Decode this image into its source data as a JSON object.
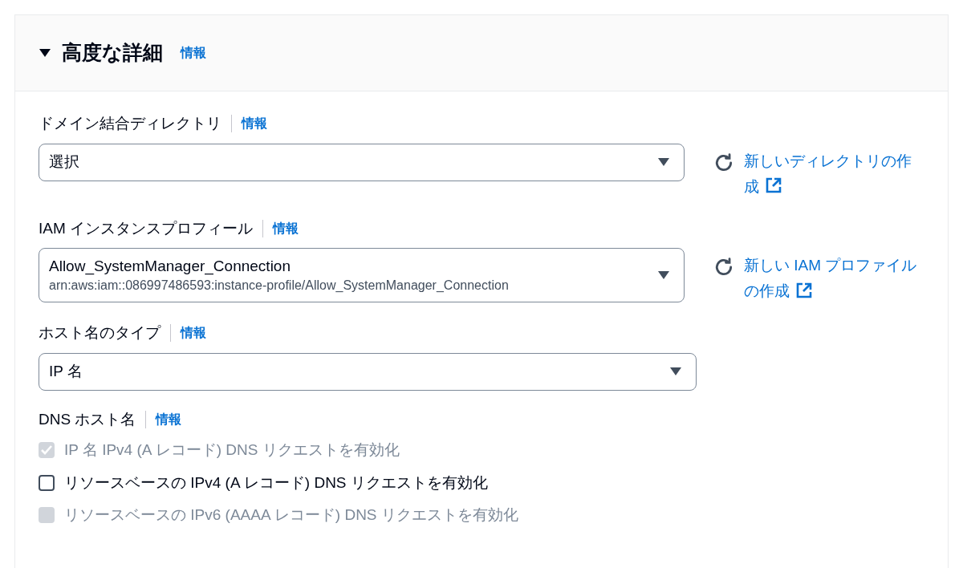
{
  "section": {
    "title": "高度な詳細",
    "info": "情報",
    "expanded": true
  },
  "fields": [
    {
      "kind": "select",
      "label": "ドメイン結合ディレクトリ",
      "info": "情報",
      "value": "選択",
      "action": "新しいディレクトリの作成"
    },
    {
      "kind": "select",
      "label": "IAM インスタンスプロフィール",
      "info": "情報",
      "value": "Allow_SystemManager_Connection",
      "description": "arn:aws:iam::086997486593:instance-profile/Allow_SystemManager_Connection",
      "action": "新しい IAM プロファイルの作成"
    },
    {
      "kind": "select",
      "label": "ホスト名のタイプ",
      "info": "情報",
      "value": "IP 名"
    },
    {
      "kind": "checkboxes",
      "label": "DNS ホスト名",
      "info": "情報",
      "options": [
        {
          "label": "IP 名 IPv4 (A レコード) DNS リクエストを有効化",
          "checked": true,
          "disabled": true
        },
        {
          "label": "リソースベースの IPv4 (A レコード) DNS リクエストを有効化",
          "checked": false,
          "disabled": false
        },
        {
          "label": "リソースベースの IPv6 (AAAA レコード) DNS リクエストを有効化",
          "checked": false,
          "disabled": true
        }
      ]
    }
  ]
}
